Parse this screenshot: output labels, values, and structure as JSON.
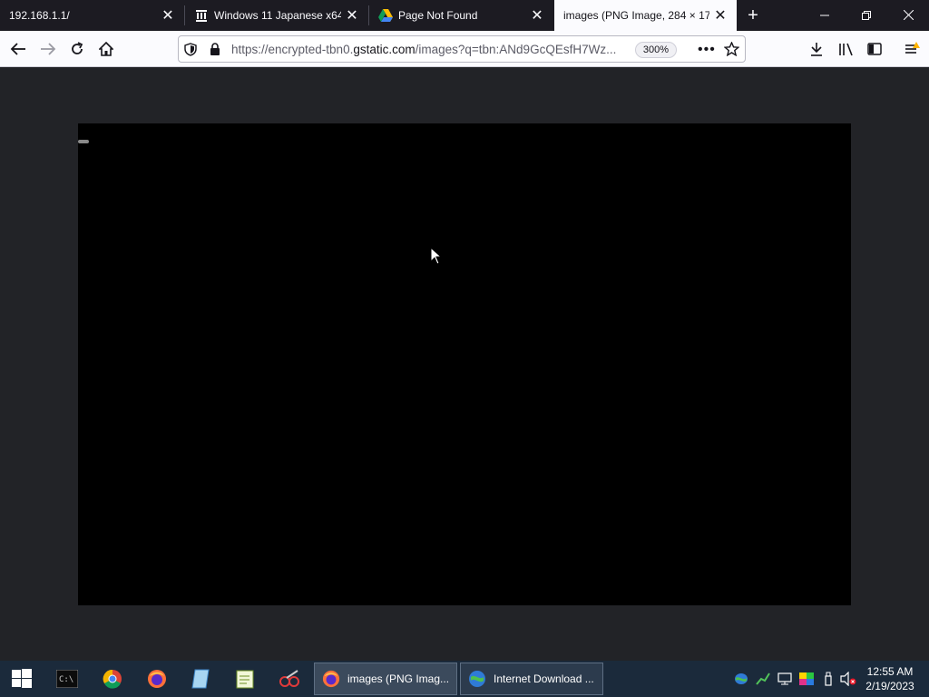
{
  "browser": {
    "tabs": [
      {
        "label": "192.168.1.1/",
        "active": false
      },
      {
        "label": "Windows 11 Japanese x64",
        "active": false
      },
      {
        "label": "Page Not Found",
        "active": false
      },
      {
        "label": "images (PNG Image, 284 × 177",
        "active": true
      }
    ],
    "url": {
      "prefix": "https://encrypted-tbn0.",
      "host": "gstatic.com",
      "suffix": "/images?q=tbn:ANd9GcQEsfH7Wz..."
    },
    "zoom": "300%"
  },
  "taskbar": {
    "apps": [
      {
        "label": "images (PNG Imag..."
      },
      {
        "label": "Internet Download ..."
      }
    ],
    "clock_time": "12:55 AM",
    "clock_date": "2/19/2023"
  },
  "colors": {
    "tab_strip": "#1c1b22",
    "toolbar": "#fbfbfe",
    "content_bg": "#222327",
    "image_bg": "#000000",
    "taskbar": "#1b2a3b"
  }
}
